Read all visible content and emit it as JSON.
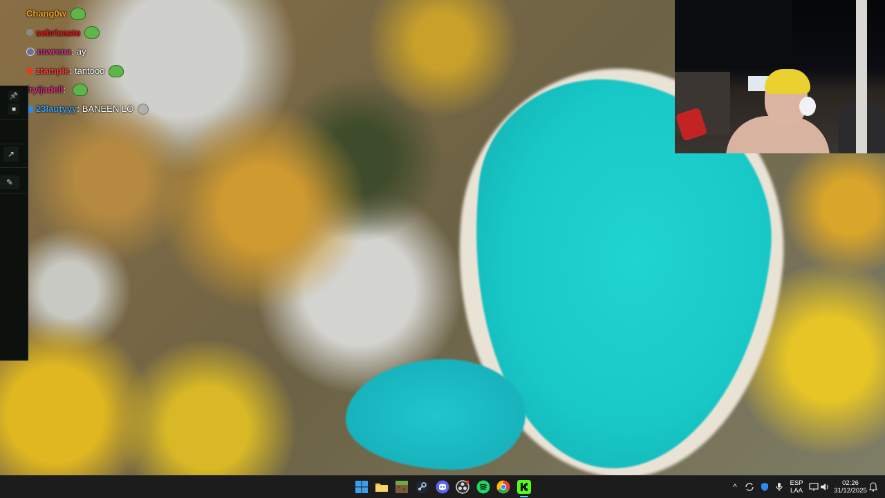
{
  "chat": {
    "messages": [
      {
        "user": "Chang0w",
        "user_color": "#f0a31e",
        "badge": "",
        "badge_color": "",
        "separator": "",
        "text": "",
        "emote": "pepe-emote"
      },
      {
        "user": "sebricaste",
        "user_color": "#e0141d",
        "badge": "gray-badge",
        "badge_color": "#8a8a8a",
        "separator": "",
        "text": "",
        "emote": "pepe-emote"
      },
      {
        "user": "mwrena",
        "user_color": "#d1358f",
        "badge": "circle-badge",
        "badge_color": "#6f6f9a",
        "separator": ":",
        "text": "ay",
        "emote": ""
      },
      {
        "user": "ztample",
        "user_color": "#ff4040",
        "badge": "red-badge",
        "badge_color": "#e23b21",
        "separator": ":",
        "text": "tantooo",
        "emote": "pepe-emote"
      },
      {
        "user": "fryijadell",
        "user_color": "#e02e8f",
        "badge": "",
        "badge_color": "",
        "separator": ":",
        "text": "",
        "emote": "pepe-emote"
      },
      {
        "user": "23lautyyy",
        "user_color": "#3aa4f0",
        "badge": "blue-badge",
        "badge_color": "#2b8ae8",
        "separator": ":",
        "text": "BANEEN LO",
        "emote": "sweat-emote"
      }
    ]
  },
  "side_panel": {
    "buttons": [
      {
        "name": "pin-button",
        "icon": "pin-icon",
        "glyph": "📌"
      },
      {
        "name": "stop-button",
        "icon": "stop-icon",
        "glyph": "■"
      },
      {
        "name": "popout-button",
        "icon": "arrow-up-right-icon",
        "glyph": "↗"
      },
      {
        "name": "edit-button",
        "icon": "pencil-icon",
        "glyph": "✎"
      }
    ]
  },
  "taskbar": {
    "apps": [
      {
        "name": "start-button",
        "icon": "windows-logo-icon",
        "color": "#3b9ff0"
      },
      {
        "name": "file-explorer-button",
        "icon": "folder-icon",
        "color": "#f4c542"
      },
      {
        "name": "minecraft-button",
        "icon": "minecraft-icon",
        "color": "#6fa84a"
      },
      {
        "name": "steam-button",
        "icon": "steam-icon",
        "color": "#1b2838"
      },
      {
        "name": "discord-button",
        "icon": "discord-icon",
        "color": "#5865f2"
      },
      {
        "name": "obs-button",
        "icon": "obs-icon",
        "color": "#d8d8d8"
      },
      {
        "name": "spotify-button",
        "icon": "spotify-icon",
        "color": "#1ed760"
      },
      {
        "name": "chrome-button",
        "icon": "chrome-icon",
        "color": "#ea4335"
      },
      {
        "name": "kick-button",
        "icon": "kick-icon",
        "color": "#53fc18"
      }
    ],
    "tray": {
      "chevron": "^",
      "language_line1": "ESP",
      "language_line2": "LAA",
      "time": "02:26",
      "date": "31/12/2025"
    }
  }
}
